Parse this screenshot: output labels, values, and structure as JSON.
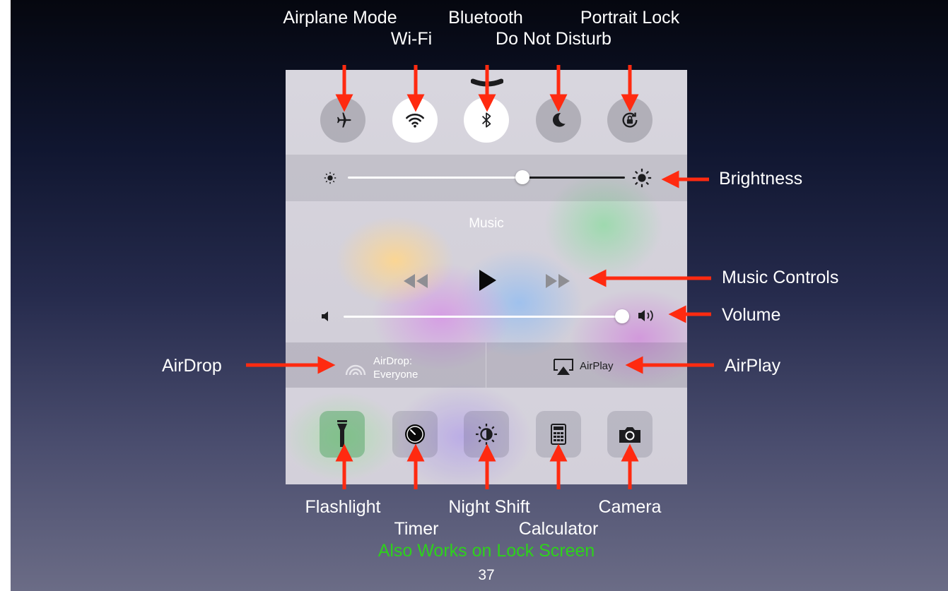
{
  "slide": {
    "page_number": "37",
    "footer_note": "Also Works on Lock Screen",
    "note_color": "#2ed11c",
    "arrow_color": "#ff2a10"
  },
  "callouts": {
    "airplane_mode": "Airplane Mode",
    "wifi": "Wi-Fi",
    "bluetooth": "Bluetooth",
    "do_not_disturb": "Do Not Disturb",
    "portrait_lock": "Portrait Lock",
    "brightness": "Brightness",
    "music_controls": "Music Controls",
    "volume": "Volume",
    "airdrop": "AirDrop",
    "airplay": "AirPlay",
    "flashlight": "Flashlight",
    "timer": "Timer",
    "night_shift": "Night Shift",
    "calculator": "Calculator",
    "camera": "Camera"
  },
  "control_center": {
    "toggles": [
      {
        "name": "airplane-mode",
        "icon": "airplane-icon",
        "on": false
      },
      {
        "name": "wifi",
        "icon": "wifi-icon",
        "on": true
      },
      {
        "name": "bluetooth",
        "icon": "bluetooth-icon",
        "on": true
      },
      {
        "name": "do-not-disturb",
        "icon": "moon-icon",
        "on": false
      },
      {
        "name": "portrait-lock",
        "icon": "rotation-lock-icon",
        "on": false
      }
    ],
    "brightness_level": 0.63,
    "music": {
      "title": "Music",
      "controls": [
        "rewind-icon",
        "play-icon",
        "fast-forward-icon"
      ]
    },
    "volume_level": 1.0,
    "airdrop": {
      "line1": "AirDrop:",
      "line2": "Everyone"
    },
    "airplay": {
      "label": "AirPlay"
    },
    "tools": [
      "flashlight-icon",
      "timer-icon",
      "night-shift-icon",
      "calculator-icon",
      "camera-icon"
    ]
  }
}
